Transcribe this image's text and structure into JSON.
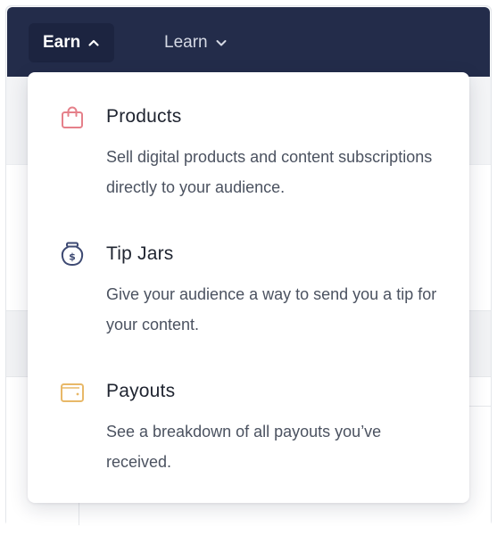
{
  "nav": {
    "earn_label": "Earn",
    "learn_label": "Learn"
  },
  "dropdown": {
    "items": [
      {
        "title": "Products",
        "description": "Sell digital products and content subscriptions directly to your audience.",
        "icon": "shopping-bag-icon",
        "icon_color": "#e5808a"
      },
      {
        "title": "Tip Jars",
        "description": "Give your audience a way to send you a tip for your content.",
        "icon": "tip-jar-icon",
        "icon_color": "#3e4a73"
      },
      {
        "title": "Payouts",
        "description": "See a breakdown of all payouts you’ve received.",
        "icon": "wallet-icon",
        "icon_color": "#e8b868"
      }
    ]
  },
  "colors": {
    "navbar": "#232c4a",
    "active_nav": "#1c2440"
  }
}
